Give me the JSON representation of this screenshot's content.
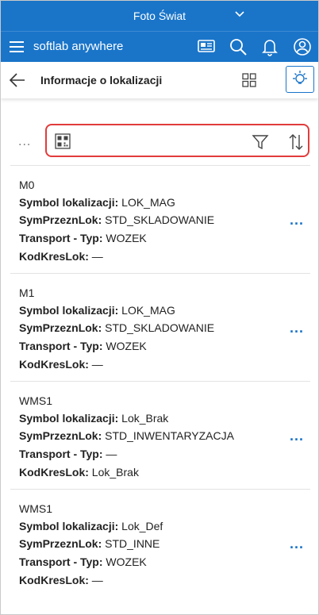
{
  "company": {
    "name": "Foto Świat"
  },
  "app": {
    "brand": "softlab anywhere"
  },
  "page": {
    "title": "Informacje o lokalizacji"
  },
  "toolbar": {
    "more": "..."
  },
  "labels": {
    "symbol": "Symbol lokalizacji:",
    "symprzezn": "SymPrzeznLok:",
    "transport": "Transport - Typ:",
    "kodkres": "KodKresLok:"
  },
  "items": [
    {
      "name": "M0",
      "symbol": "LOK_MAG",
      "symprzezn": "STD_SKLADOWANIE",
      "transport": "WOZEK",
      "kodkres": "—"
    },
    {
      "name": "M1",
      "symbol": "LOK_MAG",
      "symprzezn": "STD_SKLADOWANIE",
      "transport": "WOZEK",
      "kodkres": "—"
    },
    {
      "name": "WMS1",
      "symbol": "Lok_Brak",
      "symprzezn": "STD_INWENTARYZACJA",
      "transport": "—",
      "kodkres": "Lok_Brak"
    },
    {
      "name": "WMS1",
      "symbol": "Lok_Def",
      "symprzezn": "STD_INNE",
      "transport": "WOZEK",
      "kodkres": "—"
    }
  ],
  "colors": {
    "primary": "#1a75c9",
    "highlight": "#e23b3b"
  }
}
